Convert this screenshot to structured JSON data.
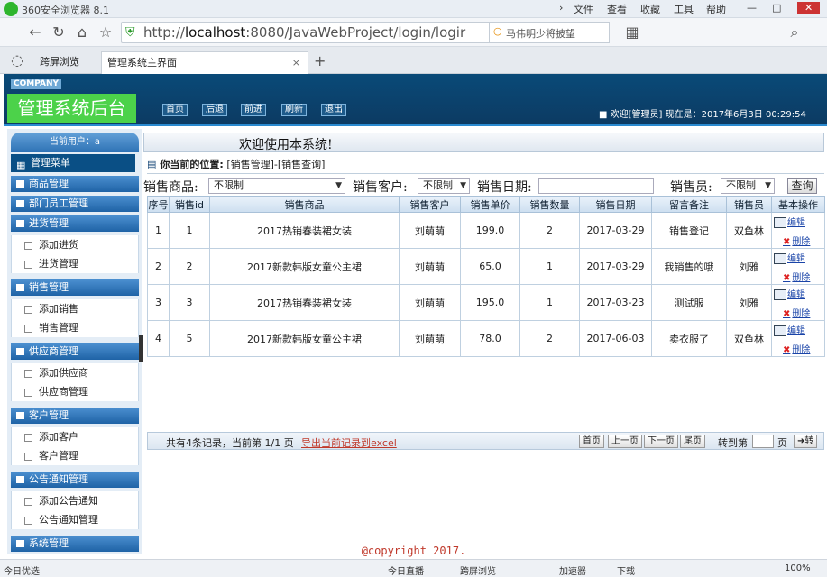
{
  "browser": {
    "title": "360安全浏览器 8.1",
    "menu": [
      "文件",
      "查看",
      "收藏",
      "工具",
      "帮助"
    ],
    "url_prefix": "http://",
    "url_host": "localhost",
    "url_rest": ":8080/JavaWebProject/login/logir",
    "search_text": "马伟明少将披望",
    "tab_split": "跨屏浏览",
    "tab_active": "管理系统主界面",
    "tab_close": "×",
    "tab_new": "+"
  },
  "app": {
    "company": "COMPANY",
    "system_title": "管理系统后台",
    "toolbar": [
      "首页",
      "后退",
      "前进",
      "刷新",
      "退出"
    ],
    "welcome": "■ 欢迎[管理员]   现在是：2017年6月3日 00:29:54"
  },
  "sidebar": {
    "current_user": "当前用户：a",
    "menu_head": "管理菜单",
    "groups": [
      {
        "label": "商品管理",
        "items": []
      },
      {
        "label": "部门员工管理",
        "items": []
      },
      {
        "label": "进货管理",
        "items": [
          "添加进货",
          "进货管理"
        ]
      },
      {
        "label": "销售管理",
        "items": [
          "添加销售",
          "销售管理"
        ]
      },
      {
        "label": "供应商管理",
        "items": [
          "添加供应商",
          "供应商管理"
        ]
      },
      {
        "label": "客户管理",
        "items": [
          "添加客户",
          "客户管理"
        ]
      },
      {
        "label": "公告通知管理",
        "items": [
          "添加公告通知",
          "公告通知管理"
        ]
      },
      {
        "label": "系统管理",
        "items": []
      }
    ]
  },
  "main": {
    "welcome_text": "欢迎使用本系统!",
    "position_label": "你当前的位置:",
    "position_path": "[销售管理]-[销售查询]",
    "filters": {
      "product_label": "销售商品:",
      "product_value": "不限制",
      "customer_label": "销售客户:",
      "customer_value": "不限制",
      "date_label": "销售日期:",
      "seller_label": "销售员:",
      "seller_value": "不限制",
      "search_btn": "查询"
    },
    "table": {
      "headers": [
        "序号",
        "销售id",
        "销售商品",
        "销售客户",
        "销售单价",
        "销售数量",
        "销售日期",
        "留言备注",
        "销售员",
        "基本操作"
      ],
      "rows": [
        [
          "1",
          "1",
          "2017热销春装裙女装",
          "刘萌萌",
          "199.0",
          "2",
          "2017-03-29",
          "销售登记",
          "双鱼林"
        ],
        [
          "2",
          "2",
          "2017新款韩版女童公主裙",
          "刘萌萌",
          "65.0",
          "1",
          "2017-03-29",
          "我销售的哦",
          "刘雅"
        ],
        [
          "3",
          "3",
          "2017热销春装裙女装",
          "刘萌萌",
          "195.0",
          "1",
          "2017-03-23",
          "测试服",
          "刘雅"
        ],
        [
          "4",
          "5",
          "2017新款韩版女童公主裙",
          "刘萌萌",
          "78.0",
          "2",
          "2017-06-03",
          "卖衣服了",
          "双鱼林"
        ]
      ],
      "edit_label": "编辑",
      "delete_label": "删除"
    },
    "pager": {
      "summary": "共有4条记录，当前第 1/1 页",
      "export": "导出当前记录到excel",
      "first": "首页",
      "prev": "上一页",
      "next": "下一页",
      "last": "尾页",
      "goto_label": "转到第",
      "page_unit": "页",
      "go_btn": "➜转"
    }
  },
  "footer": "@copyright 2017.",
  "status": {
    "left": "今日优选",
    "items": [
      "今日直播",
      "跨屏浏览",
      "加速器",
      "下载"
    ],
    "zoom": "100%"
  }
}
